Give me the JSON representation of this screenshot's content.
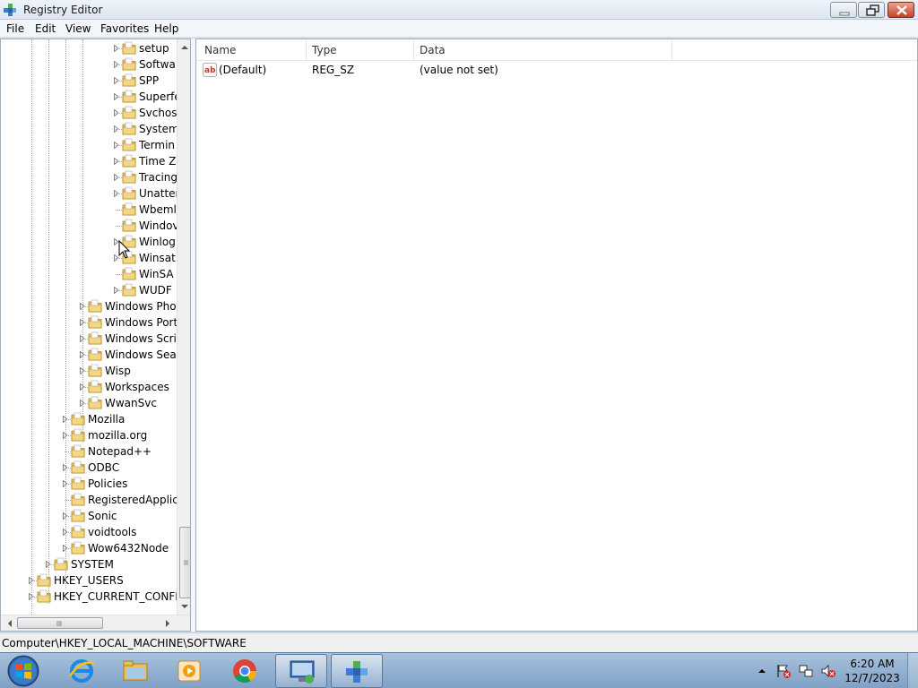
{
  "window": {
    "title": "Registry Editor"
  },
  "menu": [
    "File",
    "Edit",
    "View",
    "Favorites",
    "Help"
  ],
  "tree": {
    "items": [
      {
        "label": "setup",
        "depth": 3,
        "expander": true
      },
      {
        "label": "Softwa",
        "depth": 3,
        "expander": true
      },
      {
        "label": "SPP",
        "depth": 3,
        "expander": true
      },
      {
        "label": "Superfe",
        "depth": 3,
        "expander": true
      },
      {
        "label": "Svchos",
        "depth": 3,
        "expander": true
      },
      {
        "label": "System",
        "depth": 3,
        "expander": true
      },
      {
        "label": "Termin",
        "depth": 3,
        "expander": true
      },
      {
        "label": "Time Z",
        "depth": 3,
        "expander": true
      },
      {
        "label": "Tracing",
        "depth": 3,
        "expander": true
      },
      {
        "label": "Unatter",
        "depth": 3,
        "expander": true
      },
      {
        "label": "Wbeml",
        "depth": 3,
        "expander": false
      },
      {
        "label": "Windov",
        "depth": 3,
        "expander": false
      },
      {
        "label": "Winlog",
        "depth": 3,
        "expander": true
      },
      {
        "label": "Winsat",
        "depth": 3,
        "expander": true
      },
      {
        "label": "WinSA",
        "depth": 3,
        "expander": false
      },
      {
        "label": "WUDF",
        "depth": 3,
        "expander": true
      },
      {
        "label": "Windows Phot",
        "depth": 2,
        "expander": true
      },
      {
        "label": "Windows Port",
        "depth": 2,
        "expander": true
      },
      {
        "label": "Windows Scrip",
        "depth": 2,
        "expander": true
      },
      {
        "label": "Windows Sear",
        "depth": 2,
        "expander": true
      },
      {
        "label": "Wisp",
        "depth": 2,
        "expander": true
      },
      {
        "label": "Workspaces",
        "depth": 2,
        "expander": true
      },
      {
        "label": "WwanSvc",
        "depth": 2,
        "expander": true
      },
      {
        "label": "Mozilla",
        "depth": 1,
        "expander": true
      },
      {
        "label": "mozilla.org",
        "depth": 1,
        "expander": true
      },
      {
        "label": "Notepad++",
        "depth": 1,
        "expander": false
      },
      {
        "label": "ODBC",
        "depth": 1,
        "expander": true
      },
      {
        "label": "Policies",
        "depth": 1,
        "expander": true
      },
      {
        "label": "RegisteredApplica",
        "depth": 1,
        "expander": false
      },
      {
        "label": "Sonic",
        "depth": 1,
        "expander": true
      },
      {
        "label": "voidtools",
        "depth": 1,
        "expander": true
      },
      {
        "label": "Wow6432Node",
        "depth": 1,
        "expander": true
      },
      {
        "label": "SYSTEM",
        "depth": 0,
        "expander": true
      },
      {
        "label": "HKEY_USERS",
        "depth": -1,
        "expander": true
      },
      {
        "label": "HKEY_CURRENT_CONFIG",
        "depth": -1,
        "expander": true
      }
    ]
  },
  "values": {
    "columns": [
      "Name",
      "Type",
      "Data"
    ],
    "rows": [
      {
        "name": "(Default)",
        "type": "REG_SZ",
        "data": "(value not set)"
      }
    ]
  },
  "status": {
    "path": "Computer\\HKEY_LOCAL_MACHINE\\SOFTWARE"
  },
  "taskbar": {
    "apps": [
      {
        "name": "internet-explorer-icon",
        "active": false
      },
      {
        "name": "file-explorer-icon",
        "active": false
      },
      {
        "name": "media-player-icon",
        "active": false
      },
      {
        "name": "chrome-icon",
        "active": false
      },
      {
        "name": "remote-desktop-icon",
        "active": true
      },
      {
        "name": "registry-editor-icon",
        "active": true
      }
    ],
    "clock": {
      "time": "6:20 AM",
      "date": "12/7/2023"
    }
  },
  "colors": {
    "folder": "#e8c25a",
    "taskbar": "#8fb0d2",
    "close": "#c2432a"
  }
}
